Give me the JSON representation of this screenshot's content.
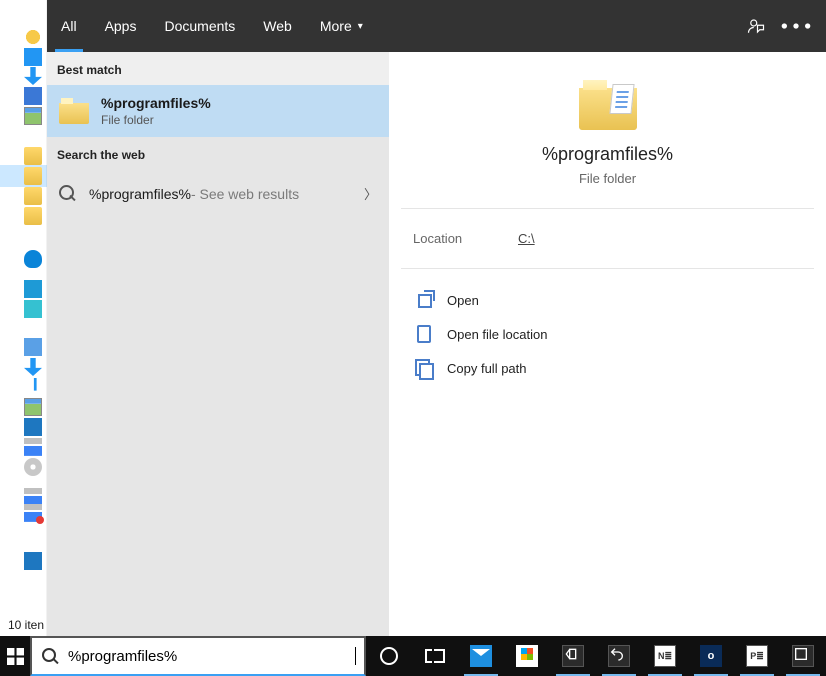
{
  "explorer": {
    "status_text": "10 iten"
  },
  "search": {
    "tabs": {
      "all": "All",
      "apps": "Apps",
      "documents": "Documents",
      "web": "Web",
      "more": "More"
    },
    "sections": {
      "best_match": "Best match",
      "search_web": "Search the web"
    },
    "best_match": {
      "title": "%programfiles%",
      "type": "File folder"
    },
    "web_result": {
      "query": "%programfiles%",
      "suffix": " - See web results"
    },
    "preview": {
      "title": "%programfiles%",
      "type": "File folder",
      "location_label": "Location",
      "location_value": "C:\\",
      "actions": {
        "open": "Open",
        "open_location": "Open file location",
        "copy_path": "Copy full path"
      }
    }
  },
  "taskbar": {
    "search_value": "%programfiles%"
  }
}
